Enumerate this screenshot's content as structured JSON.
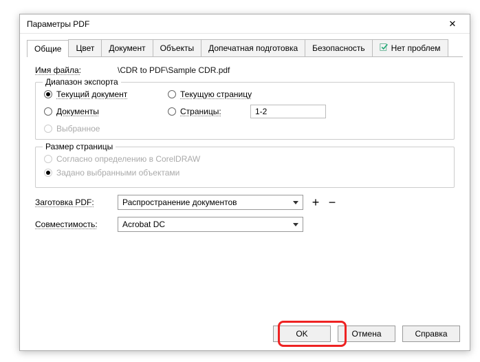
{
  "window": {
    "title": "Параметры PDF",
    "close": "✕"
  },
  "tabs": {
    "general": "Общие",
    "color": "Цвет",
    "document": "Документ",
    "objects": "Объекты",
    "prepress": "Допечатная подготовка",
    "security": "Безопасность",
    "noissues": "Нет проблем"
  },
  "filename": {
    "label": "Имя файла:",
    "value": "\\CDR to PDF\\Sample CDR.pdf"
  },
  "exportRange": {
    "title": "Диапазон экспорта",
    "currentDoc": "Текущий документ",
    "currentPage": "Текущую страницу",
    "documents": "Документы",
    "pages": "Страницы:",
    "pagesValue": "1-2",
    "selection": "Выбранное"
  },
  "pageSize": {
    "title": "Размер страницы",
    "asCorel": "Согласно определению в CorelDRAW",
    "bySelected": "Задано выбранными объектами"
  },
  "preset": {
    "label": "Заготовка PDF:",
    "value": "Распространение документов"
  },
  "compat": {
    "label": "Совместимость:",
    "value": "Acrobat DC"
  },
  "buttons": {
    "ok": "OK",
    "cancel": "Отмена",
    "help": "Справка",
    "plus": "+",
    "minus": "−"
  }
}
